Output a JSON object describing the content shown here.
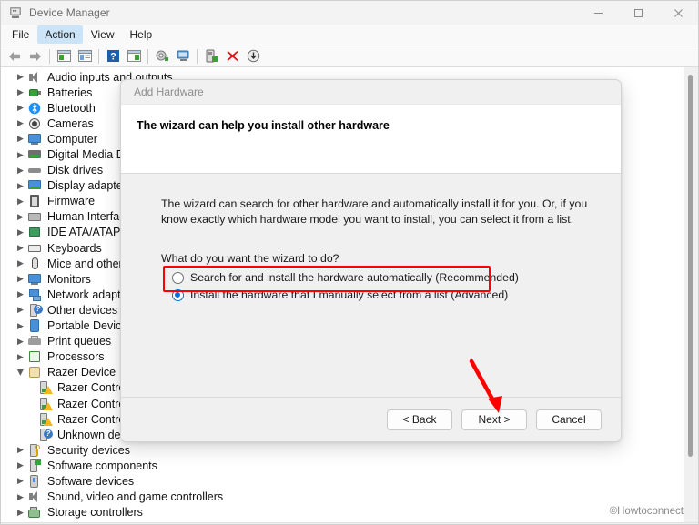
{
  "window": {
    "title": "Device Manager",
    "icon": "device-manager-icon",
    "controls": {
      "minimize": "–",
      "maximize": "❐",
      "close": "✕"
    }
  },
  "menubar": {
    "items": [
      {
        "label": "File",
        "active": false
      },
      {
        "label": "Action",
        "active": true
      },
      {
        "label": "View",
        "active": false
      },
      {
        "label": "Help",
        "active": false
      }
    ]
  },
  "toolbar": {
    "buttons": [
      {
        "name": "back-arrow-icon"
      },
      {
        "name": "forward-arrow-icon"
      },
      {
        "name": "separator-1"
      },
      {
        "name": "show-hide-console-tree-icon"
      },
      {
        "name": "properties-icon"
      },
      {
        "name": "separator-2"
      },
      {
        "name": "help-icon"
      },
      {
        "name": "show-hide-action-pane-icon"
      },
      {
        "name": "separator-3"
      },
      {
        "name": "update-driver-icon"
      },
      {
        "name": "scan-for-hardware-changes-icon"
      },
      {
        "name": "separator-4"
      },
      {
        "name": "add-legacy-hardware-icon"
      },
      {
        "name": "uninstall-device-icon"
      },
      {
        "name": "disable-device-icon"
      }
    ]
  },
  "tree": {
    "items": [
      {
        "label": "Audio inputs and outputs",
        "icon": "audio-icon",
        "expanded": false,
        "child": false
      },
      {
        "label": "Batteries",
        "icon": "battery-icon",
        "expanded": false,
        "child": false
      },
      {
        "label": "Bluetooth",
        "icon": "bluetooth-icon",
        "expanded": false,
        "child": false
      },
      {
        "label": "Cameras",
        "icon": "camera-icon",
        "expanded": false,
        "child": false
      },
      {
        "label": "Computer",
        "icon": "computer-icon",
        "expanded": false,
        "child": false
      },
      {
        "label": "Digital Media Devices",
        "icon": "digital-media-icon",
        "expanded": false,
        "child": false
      },
      {
        "label": "Disk drives",
        "icon": "disk-drive-icon",
        "expanded": false,
        "child": false
      },
      {
        "label": "Display adapters",
        "icon": "display-adapter-icon",
        "expanded": false,
        "child": false
      },
      {
        "label": "Firmware",
        "icon": "firmware-icon",
        "expanded": false,
        "child": false
      },
      {
        "label": "Human Interface Devices",
        "icon": "hid-icon",
        "expanded": false,
        "child": false
      },
      {
        "label": "IDE ATA/ATAPI controllers",
        "icon": "ide-ata-icon",
        "expanded": false,
        "child": false
      },
      {
        "label": "Keyboards",
        "icon": "keyboard-icon",
        "expanded": false,
        "child": false
      },
      {
        "label": "Mice and other pointing devices",
        "icon": "mouse-icon",
        "expanded": false,
        "child": false
      },
      {
        "label": "Monitors",
        "icon": "monitor-icon",
        "expanded": false,
        "child": false
      },
      {
        "label": "Network adapters",
        "icon": "network-adapter-icon",
        "expanded": false,
        "child": false
      },
      {
        "label": "Other devices",
        "icon": "other-device-icon",
        "expanded": false,
        "child": false
      },
      {
        "label": "Portable Devices",
        "icon": "portable-device-icon",
        "expanded": false,
        "child": false
      },
      {
        "label": "Print queues",
        "icon": "printer-icon",
        "expanded": false,
        "child": false
      },
      {
        "label": "Processors",
        "icon": "processor-icon",
        "expanded": false,
        "child": false
      },
      {
        "label": "Razer Device",
        "icon": "razer-device-icon",
        "expanded": true,
        "child": false
      },
      {
        "label": "Razer Controller",
        "icon": "razer-controller-warning-icon",
        "expanded": null,
        "child": true
      },
      {
        "label": "Razer Controller",
        "icon": "razer-controller-warning-icon",
        "expanded": null,
        "child": true
      },
      {
        "label": "Razer Controller",
        "icon": "razer-controller-warning-icon",
        "expanded": null,
        "child": true
      },
      {
        "label": "Unknown device",
        "icon": "unknown-device-icon",
        "expanded": null,
        "child": true
      },
      {
        "label": "Security devices",
        "icon": "security-device-icon",
        "expanded": false,
        "child": false
      },
      {
        "label": "Software components",
        "icon": "software-component-icon",
        "expanded": false,
        "child": false
      },
      {
        "label": "Software devices",
        "icon": "software-device-icon",
        "expanded": false,
        "child": false
      },
      {
        "label": "Sound, video and game controllers",
        "icon": "sound-video-game-icon",
        "expanded": false,
        "child": false
      },
      {
        "label": "Storage controllers",
        "icon": "storage-controller-icon",
        "expanded": false,
        "child": false
      }
    ]
  },
  "dialog": {
    "title": "Add Hardware",
    "heading": "The wizard can help you install other hardware",
    "paragraph": "The wizard can search for other hardware and automatically install it for you. Or, if you know exactly which hardware model you want to install, you can select it from a list.",
    "question": "What do you want the wizard to do?",
    "options": [
      {
        "label": "Search for and install the hardware automatically (Recommended)",
        "checked": false
      },
      {
        "label": "Install the hardware that I manually select from a list (Advanced)",
        "checked": true
      }
    ],
    "buttons": {
      "back": "< Back",
      "next": "Next >",
      "cancel": "Cancel"
    }
  },
  "annotations": {
    "highlight_color": "#ff0000",
    "arrow_color": "#ff0000"
  },
  "watermark": "©Howtoconnect"
}
